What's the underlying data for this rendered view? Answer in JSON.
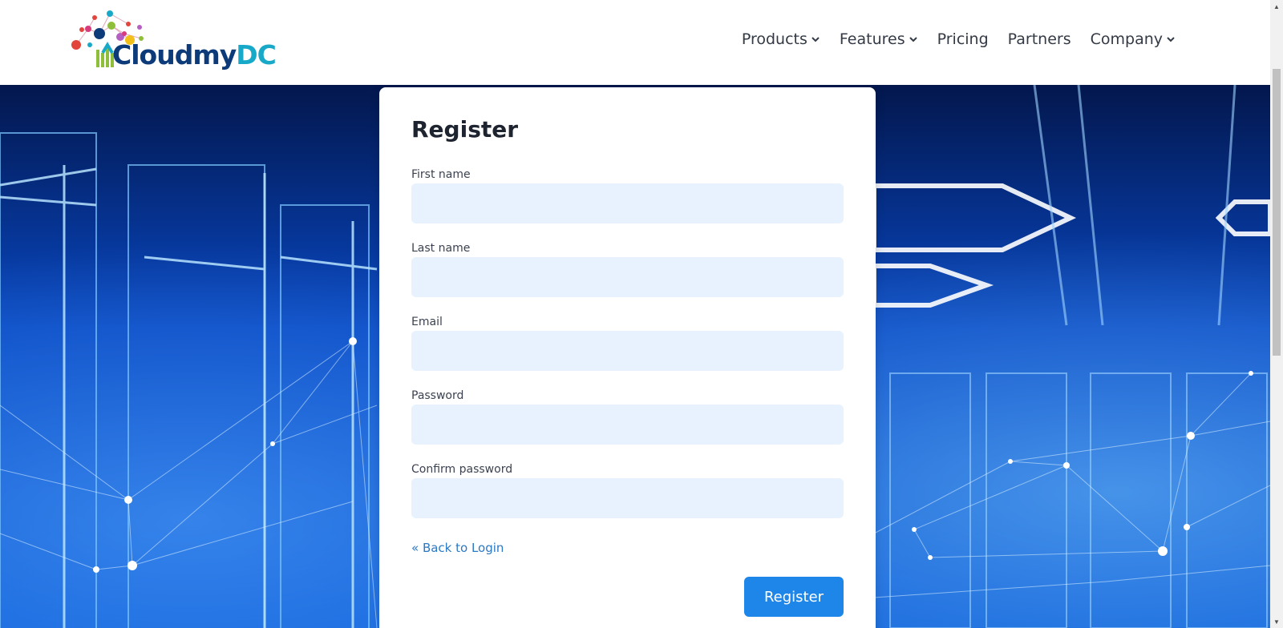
{
  "header": {
    "logo": {
      "text_part1": "Cloudmy",
      "text_part2": "DC"
    },
    "nav": [
      {
        "label": "Products",
        "has_dropdown": true
      },
      {
        "label": "Features",
        "has_dropdown": true
      },
      {
        "label": "Pricing",
        "has_dropdown": false
      },
      {
        "label": "Partners",
        "has_dropdown": false
      },
      {
        "label": "Company",
        "has_dropdown": true
      }
    ]
  },
  "form": {
    "title": "Register",
    "fields": [
      {
        "label": "First name",
        "value": "",
        "type": "text"
      },
      {
        "label": "Last name",
        "value": "",
        "type": "text"
      },
      {
        "label": "Email",
        "value": "",
        "type": "email"
      },
      {
        "label": "Password",
        "value": "",
        "type": "password"
      },
      {
        "label": "Confirm password",
        "value": "",
        "type": "password"
      }
    ],
    "back_link": "« Back to Login",
    "submit_label": "Register"
  },
  "colors": {
    "accent": "#1f86e9",
    "input_bg": "#e7f2fe",
    "link": "#2b79c2",
    "logo_dark": "#0d3b7a",
    "logo_teal": "#18a8c8"
  }
}
